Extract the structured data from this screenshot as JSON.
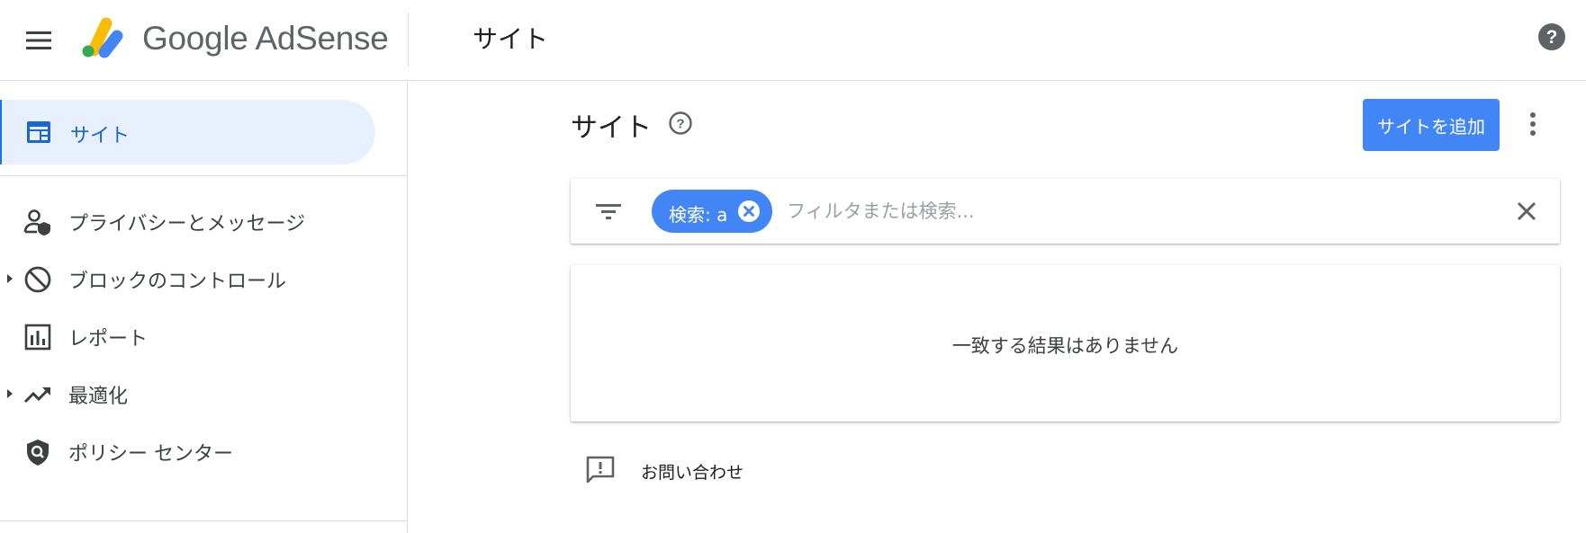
{
  "header": {
    "brand": "Google AdSense",
    "title": "サイト"
  },
  "sidebar": {
    "items": [
      {
        "label": "サイト",
        "icon": "sites-icon",
        "active": true
      },
      {
        "label": "プライバシーとメッセージ",
        "icon": "person-shield-icon"
      },
      {
        "label": "ブロックのコントロール",
        "icon": "block-icon",
        "expandable": true
      },
      {
        "label": "レポート",
        "icon": "bar-chart-icon"
      },
      {
        "label": "最適化",
        "icon": "trending-up-icon",
        "expandable": true
      },
      {
        "label": "ポリシー センター",
        "icon": "policy-shield-icon"
      }
    ]
  },
  "main": {
    "title": "サイト",
    "add_button": "サイトを追加",
    "filter": {
      "chip_label": "検索: a",
      "placeholder": "フィルタまたは検索..."
    },
    "empty_message": "一致する結果はありません",
    "contact_label": "お問い合わせ"
  },
  "colors": {
    "accent": "#4285f4",
    "active_bg": "#e8f0fe",
    "active_text": "#1967d2"
  }
}
